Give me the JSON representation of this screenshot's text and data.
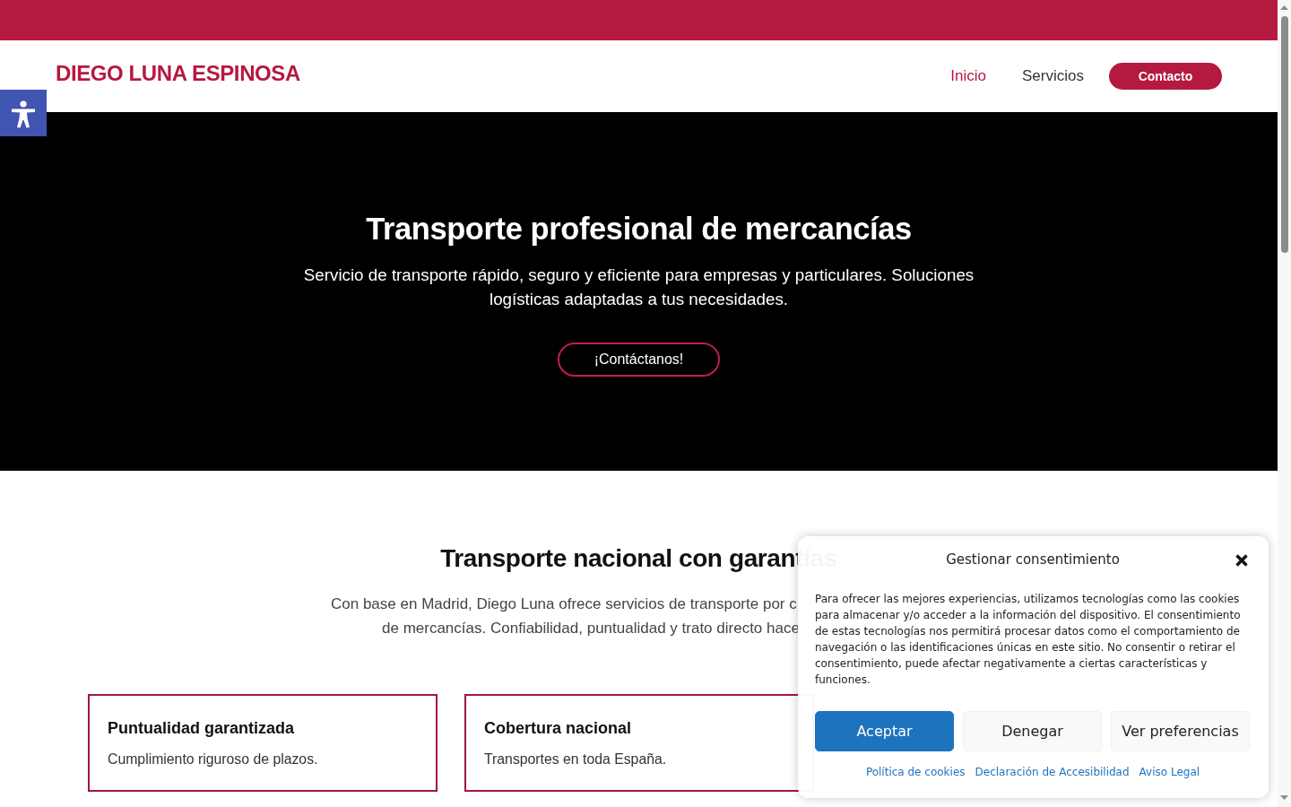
{
  "header": {
    "logo": "DIEGO LUNA ESPINOSA",
    "nav": [
      {
        "label": "Inicio",
        "selected": true
      },
      {
        "label": "Servicios",
        "selected": false
      }
    ],
    "cta": "Contacto"
  },
  "hero": {
    "title": "Transporte profesional de mercancías",
    "subtitle": "Servicio de transporte rápido, seguro y eficiente para empresas y particulares. Soluciones logísticas adaptadas a tus necesidades.",
    "button": "¡Contáctanos!"
  },
  "section": {
    "title": "Transporte nacional con garantías",
    "intro_lines": [
      "Con base en Madrid, Diego Luna ofrece servicios de transporte por c",
      "de mercancías. Confiabilidad, puntualidad y trato directo hace"
    ]
  },
  "features": [
    {
      "title": "Puntualidad garantizada",
      "description": "Cumplimiento riguroso de plazos."
    },
    {
      "title": "Cobertura nacional",
      "description": "Transportes en toda España."
    }
  ],
  "cookie_dialog": {
    "title": "Gestionar consentimiento",
    "body": "Para ofrecer las mejores experiencias, utilizamos tecnologías como las cookies para almacenar y/o acceder a la información del dispositivo. El consentimiento de estas tecnologías nos permitirá procesar datos como el comportamiento de navegación o las identificaciones únicas en este sitio. No consentir o retirar el consentimiento, puede afectar negativamente a ciertas características y funciones.",
    "buttons": [
      {
        "label": "Aceptar",
        "kind": "primary"
      },
      {
        "label": "Denegar",
        "kind": "secondary"
      },
      {
        "label": "Ver preferencias",
        "kind": "secondary"
      }
    ],
    "links": [
      "Política de cookies",
      "Declaración de Accesibilidad",
      "Aviso Legal"
    ]
  }
}
